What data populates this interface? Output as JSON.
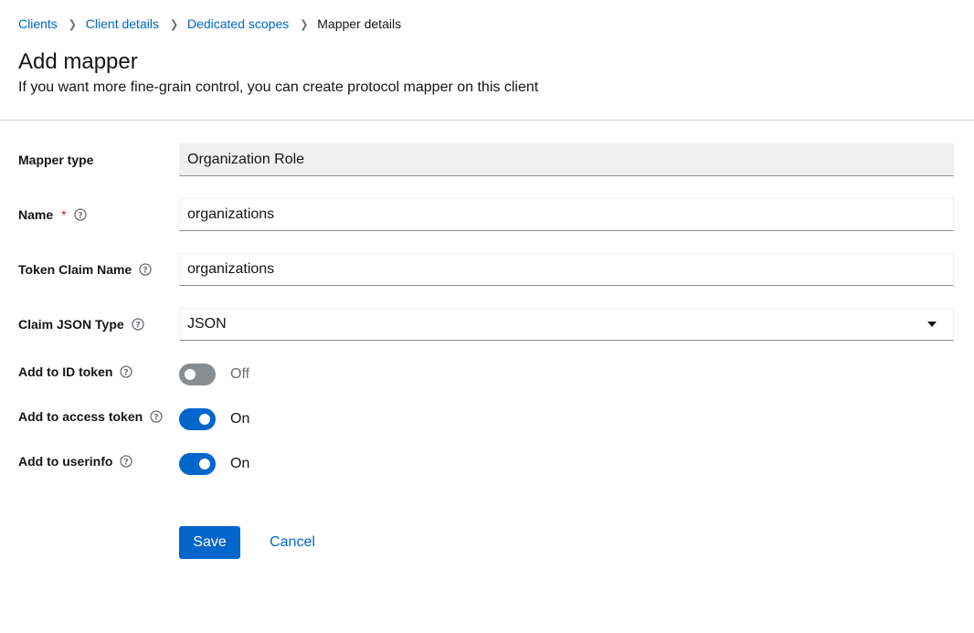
{
  "breadcrumb": {
    "items": [
      "Clients",
      "Client details",
      "Dedicated scopes"
    ],
    "current": "Mapper details"
  },
  "header": {
    "title": "Add mapper",
    "subtitle": "If you want more fine-grain control, you can create protocol mapper on this client"
  },
  "form": {
    "mapper_type": {
      "label": "Mapper type",
      "value": "Organization Role"
    },
    "name": {
      "label": "Name",
      "required_mark": "*",
      "value": "organizations"
    },
    "token_claim_name": {
      "label": "Token Claim Name",
      "value": "organizations"
    },
    "claim_json_type": {
      "label": "Claim JSON Type",
      "value": "JSON"
    },
    "add_to_id_token": {
      "label": "Add to ID token",
      "state": "Off"
    },
    "add_to_access_token": {
      "label": "Add to access token",
      "state": "On"
    },
    "add_to_userinfo": {
      "label": "Add to userinfo",
      "state": "On"
    }
  },
  "actions": {
    "save_label": "Save",
    "cancel_label": "Cancel"
  },
  "colors": {
    "accent": "#0066cc",
    "required": "#c9190b",
    "switch_off": "#8a8d90"
  },
  "icons": {
    "help": "help-circle-icon",
    "separator": "chevron-right-icon",
    "dropdown": "caret-down-icon"
  }
}
